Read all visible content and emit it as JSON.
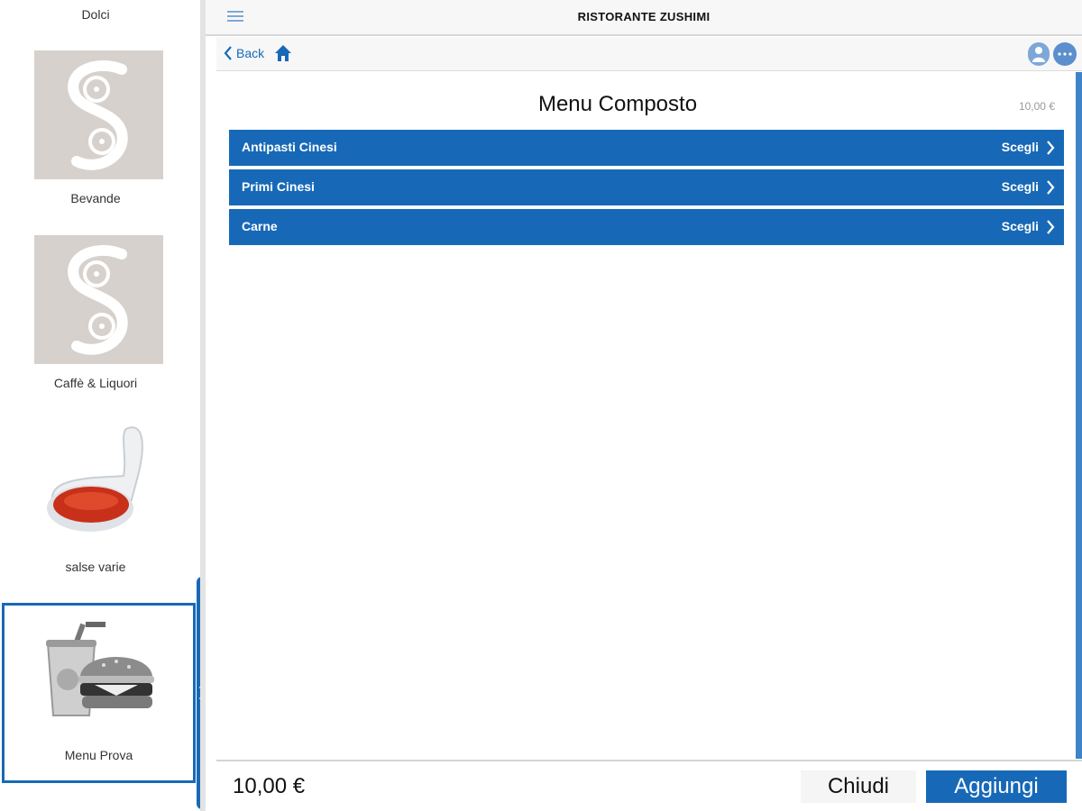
{
  "app": {
    "title": "RISTORANTE ZUSHIMI"
  },
  "nav": {
    "back_label": "Back"
  },
  "sidebar": {
    "categories": [
      {
        "label": "Dolci"
      },
      {
        "label": "Bevande",
        "thumb": "logo-s"
      },
      {
        "label": "Caffè & Liquori",
        "thumb": "logo-s"
      },
      {
        "label": "salse varie",
        "thumb": "sauce-spoon"
      },
      {
        "label": "Menu Prova",
        "thumb": "burger-drink",
        "selected": true
      }
    ]
  },
  "main": {
    "title": "Menu Composto",
    "price": "10,00 €",
    "rows": [
      {
        "label": "Antipasti Cinesi",
        "action": "Scegli"
      },
      {
        "label": "Primi Cinesi",
        "action": "Scegli"
      },
      {
        "label": "Carne",
        "action": "Scegli"
      }
    ]
  },
  "footer": {
    "total": "10,00 €",
    "close_label": "Chiudi",
    "add_label": "Aggiungi"
  },
  "colors": {
    "accent": "#1769b7",
    "thumb_bg": "#d6d1cc"
  }
}
